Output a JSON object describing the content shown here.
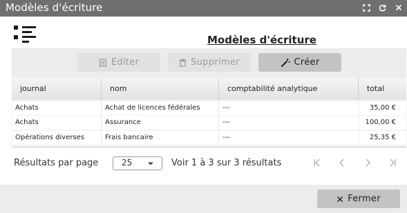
{
  "window": {
    "title": "Modèles d'écriture",
    "icons": [
      "expand-icon",
      "refresh-icon",
      "close-icon"
    ]
  },
  "page": {
    "title": "Modèles d'écriture"
  },
  "toolbar": {
    "edit_label": "Editer",
    "delete_label": "Supprimer",
    "create_label": "Créer"
  },
  "grid": {
    "columns": [
      "journal",
      "nom",
      "comptabilité analytique",
      "total"
    ],
    "rows": [
      {
        "journal": "Achats",
        "nom": "Achat de licences fédérales",
        "analytique": "---",
        "total": "35,00 €"
      },
      {
        "journal": "Achats",
        "nom": "Assurance",
        "analytique": "---",
        "total": "100,00 €"
      },
      {
        "journal": "Opérations diverses",
        "nom": "Frais bancaire",
        "analytique": "---",
        "total": "25,35 €"
      }
    ]
  },
  "pager": {
    "per_page_label": "Résultats par page",
    "per_page_value": "25",
    "range_text": "Voir 1 à 3 sur 3 résultats"
  },
  "footer": {
    "close_label": "Fermer"
  },
  "colors": {
    "titlebar": "#6f6f6f",
    "toolbar_bg": "#ececec",
    "primary_button": "#c3c3c3",
    "disabled_button": "#e2e2e2"
  }
}
